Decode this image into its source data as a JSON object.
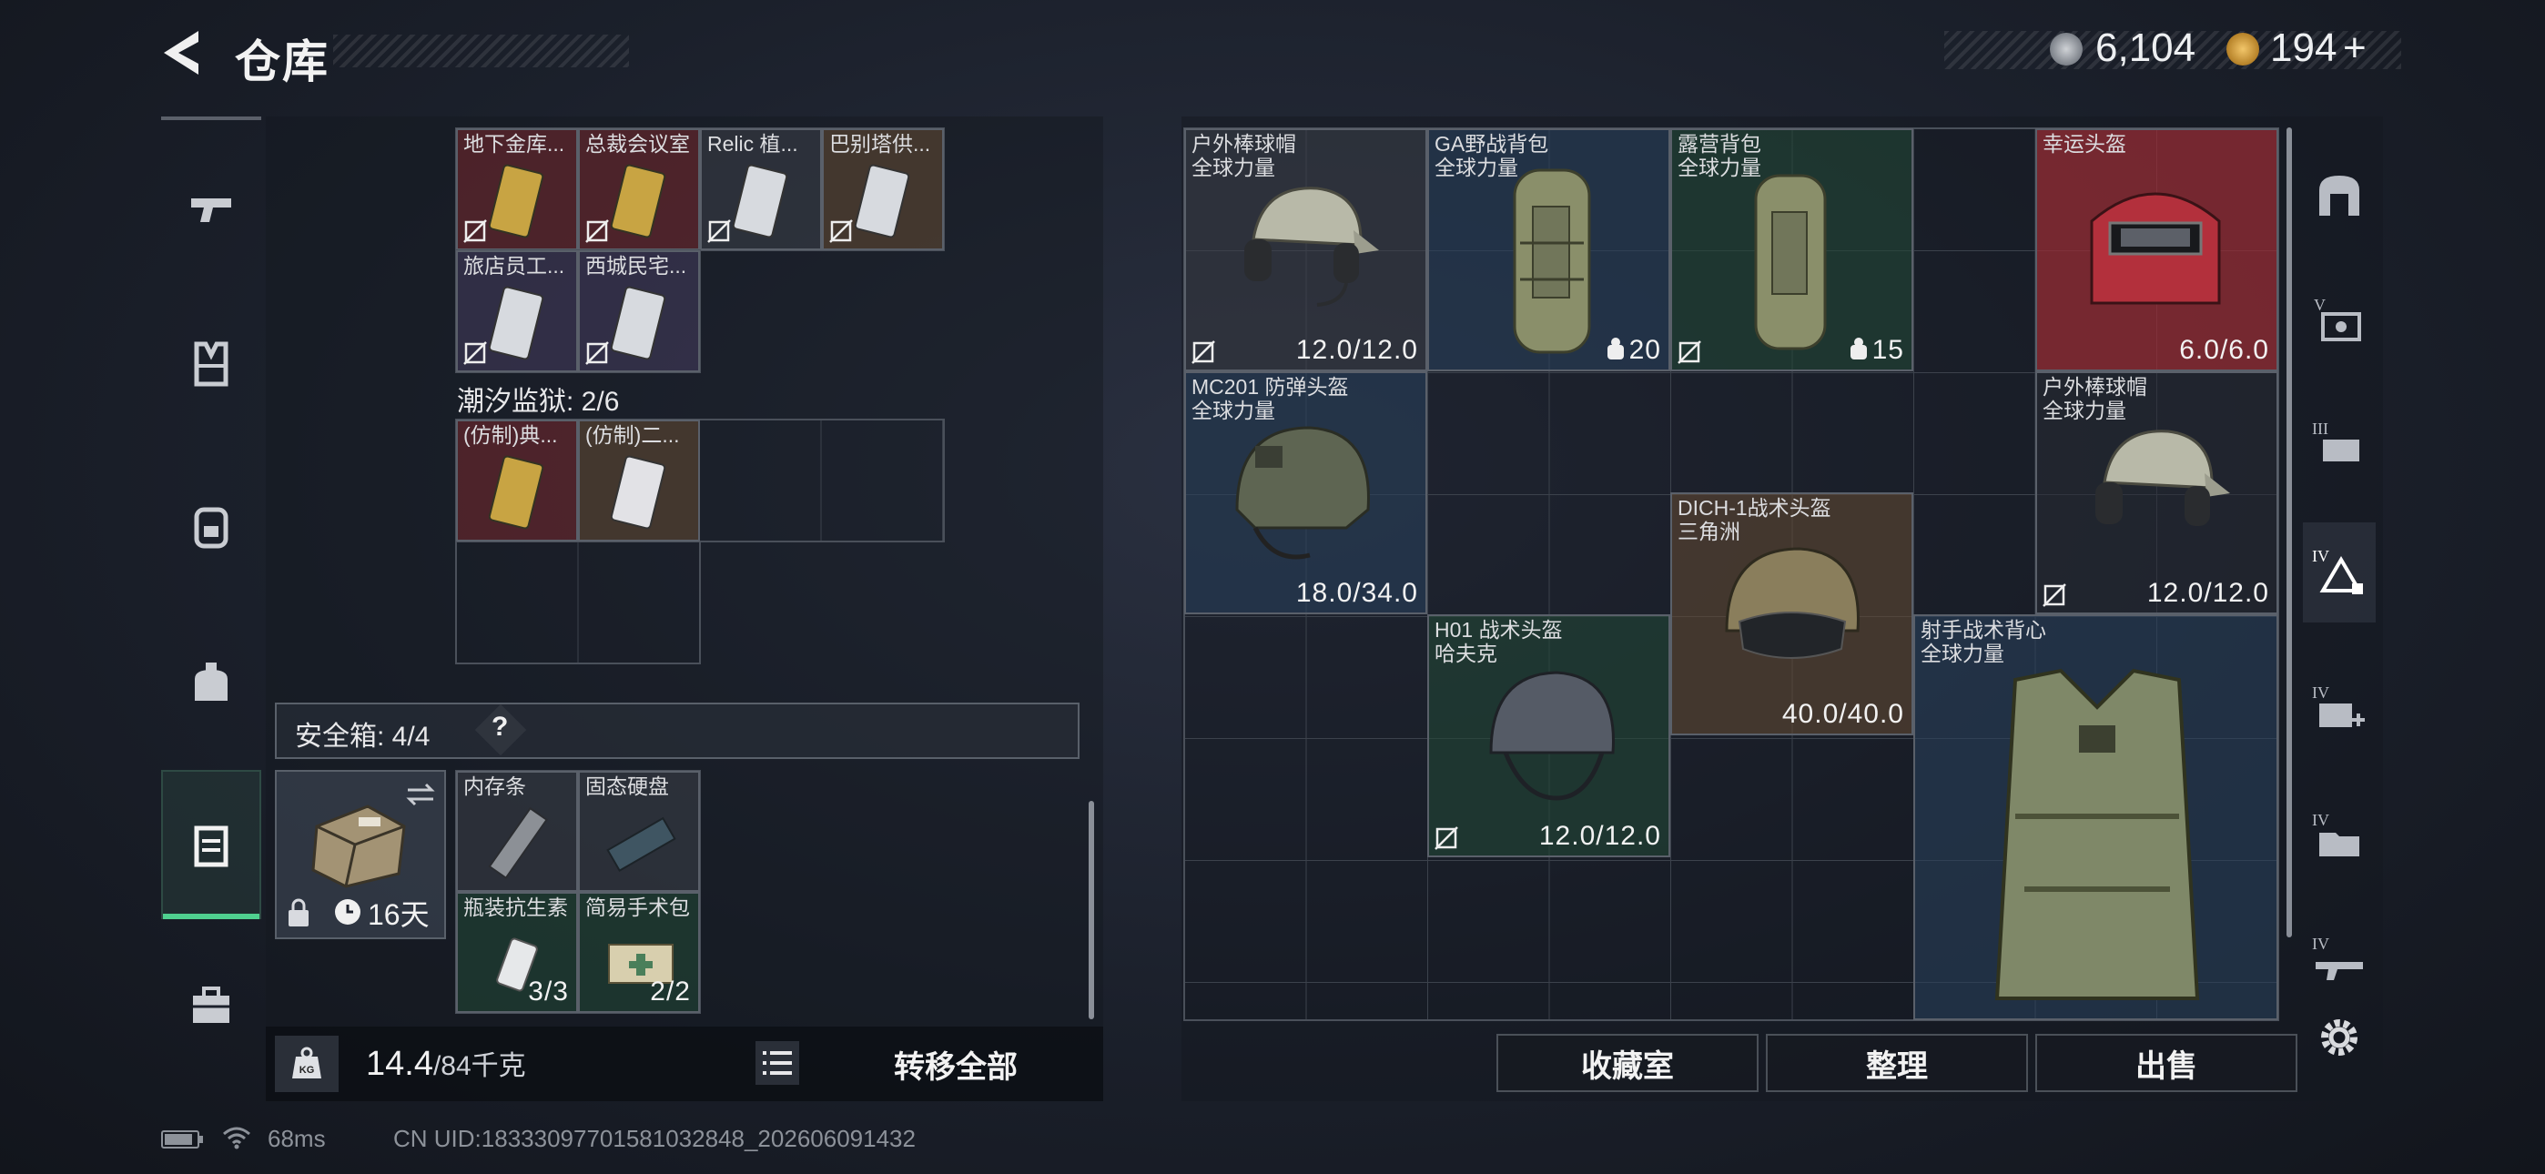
{
  "header": {
    "title": "仓库"
  },
  "currency": {
    "coins": "6,104",
    "tokens": "194",
    "add": "+"
  },
  "left": {
    "vault_row1": [
      {
        "name": "地下金库...",
        "bg": "red"
      },
      {
        "name": "总裁会议室",
        "bg": "red"
      },
      {
        "name": "Relic 植...",
        "bg": "gray"
      },
      {
        "name": "巴别塔供...",
        "bg": "brown"
      }
    ],
    "vault_row2": [
      {
        "name": "旅店员工...",
        "bg": "purple"
      },
      {
        "name": "西城民宅...",
        "bg": "purple"
      }
    ],
    "prison_label": "潮汐监狱: 2/6",
    "prison_row": [
      {
        "name": "(仿制)典...",
        "bg": "red"
      },
      {
        "name": "(仿制)二...",
        "bg": "brown"
      }
    ],
    "safebox": {
      "label": "安全箱: 4/4",
      "help": "?",
      "days": "16天"
    },
    "safebox_items": [
      {
        "name": "内存条",
        "count": ""
      },
      {
        "name": "固态硬盘",
        "count": ""
      },
      {
        "name": "瓶装抗生素",
        "count": "3/3"
      },
      {
        "name": "简易手术包",
        "count": "2/2"
      }
    ],
    "weight_value": "14.4",
    "weight_max": "/84千克",
    "transfer_all": "转移全部"
  },
  "right": {
    "items": [
      {
        "name": "户外棒球帽",
        "sub": "全球力量",
        "value": "12.0/12.0"
      },
      {
        "name": "GA野战背包",
        "sub": "全球力量",
        "value": "20"
      },
      {
        "name": "露营背包",
        "sub": "全球力量",
        "value": "15"
      },
      {
        "name": "幸运头盔",
        "sub": "",
        "value": "6.0/6.0"
      },
      {
        "name": "MC201 防弹头盔",
        "sub": "全球力量",
        "value": "18.0/34.0"
      },
      {
        "name": "户外棒球帽",
        "sub": "全球力量",
        "value": "12.0/12.0"
      },
      {
        "name": "DICH-1战术头盔",
        "sub": "三角洲",
        "value": "40.0/40.0"
      },
      {
        "name": "H01 战术头盔",
        "sub": "哈夫克",
        "value": "12.0/12.0"
      },
      {
        "name": "射手战术背心",
        "sub": "全球力量",
        "value": ""
      }
    ],
    "buttons": {
      "collection": "收藏室",
      "sort": "整理",
      "sell": "出售"
    }
  },
  "footer": {
    "ping": "68ms",
    "uid": "CN UID:18333097701581032848_202606091432"
  },
  "colors": {
    "accent_green": "#4fd08f",
    "currency_gold": "#d8a447"
  }
}
